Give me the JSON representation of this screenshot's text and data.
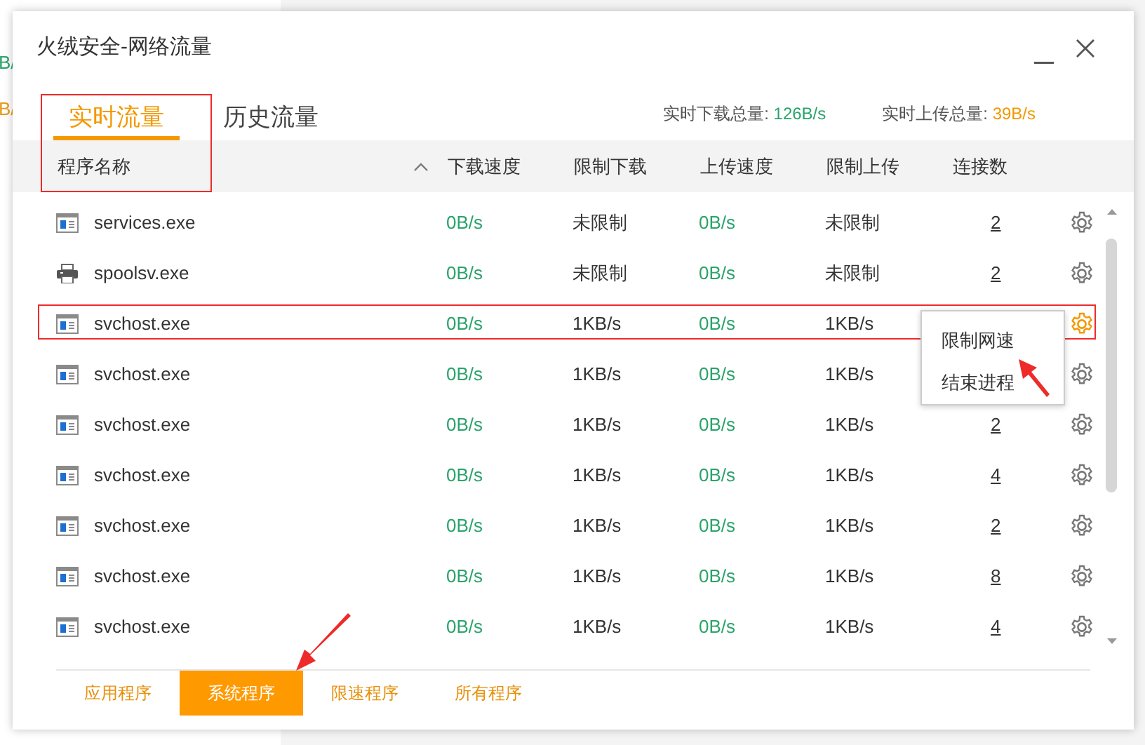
{
  "background_fragments": [
    {
      "text": "B/",
      "color": "#2aa36b"
    },
    {
      "text": "B/",
      "color": "#e89a1c"
    }
  ],
  "window": {
    "title": "火绒安全-网络流量"
  },
  "tabs": [
    {
      "label": "实时流量",
      "selected": true
    },
    {
      "label": "历史流量",
      "selected": false
    }
  ],
  "totals": [
    {
      "label": "实时下载总量: ",
      "value": "126B/s",
      "color": "#2aa36b"
    },
    {
      "label": "实时上传总量: ",
      "value": "39B/s",
      "color": "#f39800"
    }
  ],
  "table": {
    "columns": [
      "程序名称",
      "下载速度",
      "限制下载",
      "上传速度",
      "限制上传",
      "连接数"
    ],
    "rows": [
      {
        "kind": "window",
        "name": "services.exe",
        "download": "0B/s",
        "download_limit": "未限制",
        "upload": "0B/s",
        "upload_limit": "未限制",
        "connections": "2",
        "selected": false
      },
      {
        "kind": "printer",
        "name": "spoolsv.exe",
        "download": "0B/s",
        "download_limit": "未限制",
        "upload": "0B/s",
        "upload_limit": "未限制",
        "connections": "2",
        "selected": false
      },
      {
        "kind": "window",
        "name": "svchost.exe",
        "download": "0B/s",
        "download_limit": "1KB/s",
        "upload": "0B/s",
        "upload_limit": "1KB/s",
        "selected": true
      },
      {
        "kind": "window",
        "name": "svchost.exe",
        "download": "0B/s",
        "download_limit": "1KB/s",
        "upload": "0B/s",
        "upload_limit": "1KB/s",
        "selected": false
      },
      {
        "kind": "window",
        "name": "svchost.exe",
        "download": "0B/s",
        "download_limit": "1KB/s",
        "upload": "0B/s",
        "upload_limit": "1KB/s",
        "connections": "2",
        "selected": false
      },
      {
        "kind": "window",
        "name": "svchost.exe",
        "download": "0B/s",
        "download_limit": "1KB/s",
        "upload": "0B/s",
        "upload_limit": "1KB/s",
        "connections": "4",
        "selected": false
      },
      {
        "kind": "window",
        "name": "svchost.exe",
        "download": "0B/s",
        "download_limit": "1KB/s",
        "upload": "0B/s",
        "upload_limit": "1KB/s",
        "connections": "2",
        "selected": false
      },
      {
        "kind": "window",
        "name": "svchost.exe",
        "download": "0B/s",
        "download_limit": "1KB/s",
        "upload": "0B/s",
        "upload_limit": "1KB/s",
        "connections": "8",
        "selected": false
      },
      {
        "kind": "window",
        "name": "svchost.exe",
        "download": "0B/s",
        "download_limit": "1KB/s",
        "upload": "0B/s",
        "upload_limit": "1KB/s",
        "connections": "4",
        "selected": false
      }
    ]
  },
  "context_menu": {
    "items": [
      "限制网速",
      "结束进程"
    ]
  },
  "bottom_tabs": [
    {
      "label": "应用程序",
      "selected": false
    },
    {
      "label": "系统程序",
      "selected": true
    },
    {
      "label": "限速程序",
      "selected": false
    },
    {
      "label": "所有程序",
      "selected": false
    }
  ]
}
